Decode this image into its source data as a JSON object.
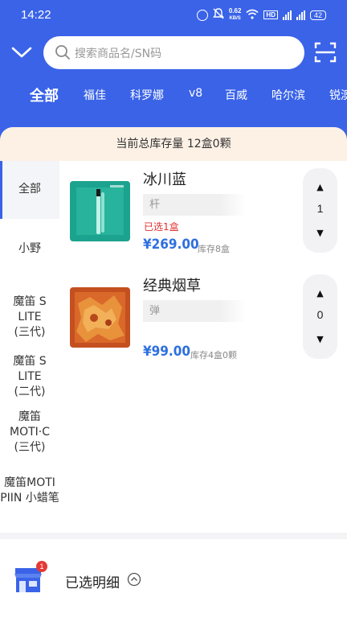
{
  "status_bar": {
    "time": "14:22",
    "net_speed_value": "0.62",
    "net_speed_unit": "KB/S",
    "hd_label": "HD",
    "battery": "42"
  },
  "search": {
    "placeholder": "搜索商品名/SN码"
  },
  "brand_tabs": [
    {
      "label": "全部",
      "active": true
    },
    {
      "label": "福佳"
    },
    {
      "label": "科罗娜"
    },
    {
      "label": "v8"
    },
    {
      "label": "百威"
    },
    {
      "label": "哈尔滨"
    },
    {
      "label": "锐澳"
    }
  ],
  "summary": "当前总库存量 12盒0颗",
  "categories": [
    {
      "label": "全部",
      "active": true
    },
    {
      "label": "小野"
    },
    {
      "label_line1": "魔笛 S LITE",
      "label_line2": "(三代)"
    },
    {
      "label_line1": "魔笛 S LITE",
      "label_line2": "(二代)"
    },
    {
      "label_line1": "魔笛",
      "label_line2": "MOTI·C",
      "label_line3": "(三代)"
    },
    {
      "label_line1": "魔笛MOTI",
      "label_line2": "PIIN 小蜡笔"
    }
  ],
  "products": [
    {
      "name": "冰川蓝",
      "spec": "杆",
      "selected_note": "已选1盒",
      "price": "¥269.00",
      "stock": "库存8盒",
      "quantity": "1",
      "image_icon": "vape-pen-icon"
    },
    {
      "name": "经典烟草",
      "spec": "弹",
      "price": "¥99.00",
      "stock": "库存4盒0颗",
      "quantity": "0",
      "image_icon": "tobacco-icon"
    }
  ],
  "stepper_up": "▲",
  "stepper_down": "▼",
  "bottom": {
    "badge": "1",
    "label": "已选明细"
  },
  "colors": {
    "brand": "#3a63e8",
    "price": "#2e6fe0",
    "alert": "#e03030",
    "summary_bg": "#fdf1e6"
  }
}
